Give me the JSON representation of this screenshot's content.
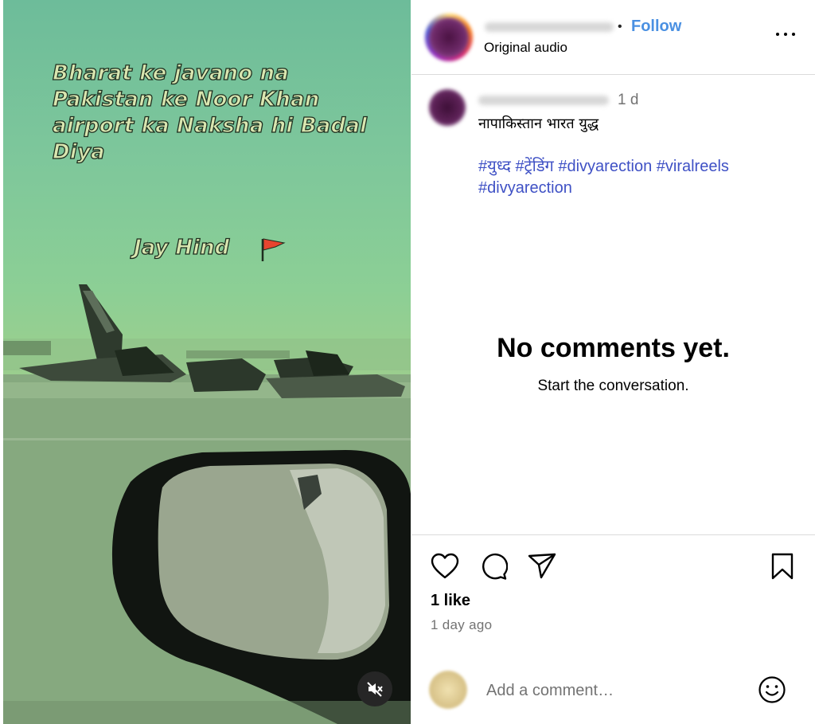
{
  "media": {
    "overlay_text": "Bharat ke javano na\nPakistan ke Noor Khan\nairport  ka Naksha hi Badal\nDiya",
    "sub_text": "Jay Hind",
    "flag_icon": "red-flag-icon",
    "mute_icon": "speaker-muted-icon"
  },
  "header": {
    "separator": "•",
    "follow_label": "Follow",
    "audio_label": "Original audio",
    "more_icon": "more-options-icon"
  },
  "caption": {
    "time": "1 d",
    "text": "नापाकिस्तान भारत युद्ध",
    "hashtags": [
      "#युध्द",
      "#ट्रेंडिंग",
      "#divyarection",
      "#viralreels",
      "#divyarection"
    ]
  },
  "comments": {
    "empty_title": "No comments yet.",
    "empty_subtitle": "Start the conversation."
  },
  "actions": {
    "like_icon": "heart-icon",
    "comment_icon": "comment-bubble-icon",
    "share_icon": "paper-plane-icon",
    "save_icon": "bookmark-icon",
    "likes": "1 like",
    "time_ago": "1 day ago"
  },
  "comment_box": {
    "placeholder": "Add a comment…",
    "emoji_icon": "smiley-icon"
  },
  "colors": {
    "follow": "#4a90e2",
    "hashtag": "#3f51c5",
    "muted_text": "#737373",
    "divider": "#dbdbdb"
  }
}
